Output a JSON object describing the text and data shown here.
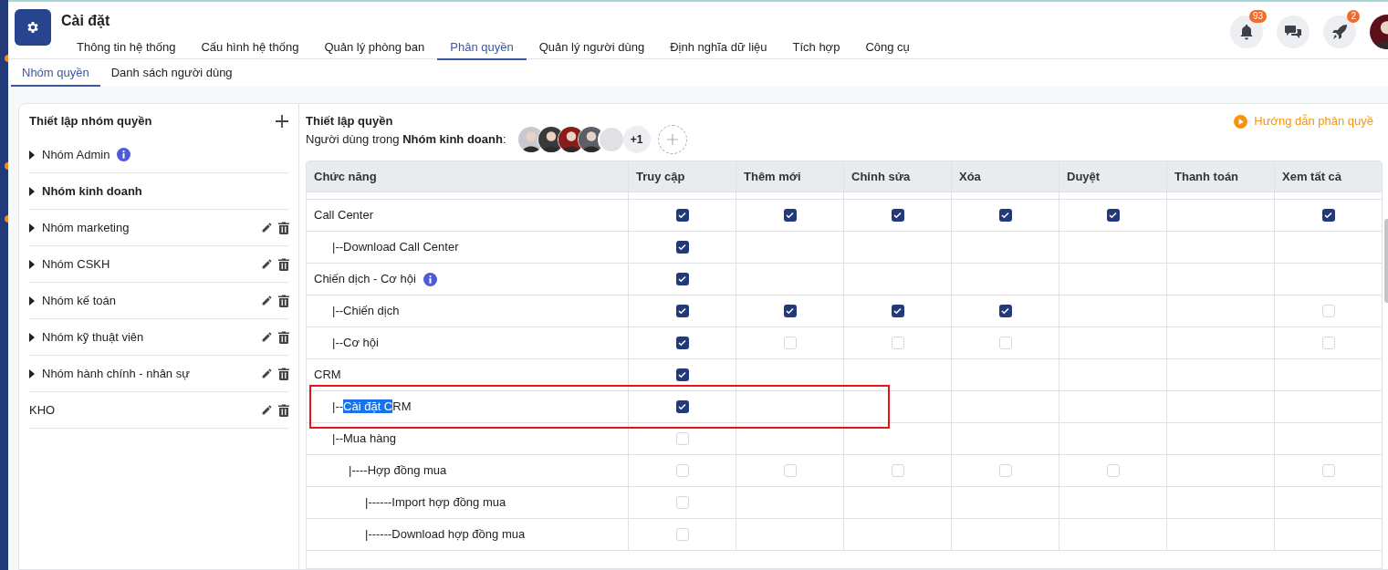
{
  "app": {
    "title": "Cài đặt"
  },
  "nav_tabs": [
    {
      "label": "Thông tin hệ thống",
      "selected": false
    },
    {
      "label": "Cấu hình hệ thống",
      "selected": false
    },
    {
      "label": "Quản lý phòng ban",
      "selected": false
    },
    {
      "label": "Phân quyền",
      "selected": true
    },
    {
      "label": "Quản lý người dùng",
      "selected": false
    },
    {
      "label": "Định nghĩa dữ liệu",
      "selected": false
    },
    {
      "label": "Tích hợp",
      "selected": false
    },
    {
      "label": "Công cụ",
      "selected": false
    }
  ],
  "header_actions": [
    {
      "kind": "bell",
      "badge": "93"
    },
    {
      "kind": "chat"
    },
    {
      "kind": "rocket",
      "badge": "2"
    },
    {
      "kind": "avatar"
    }
  ],
  "sub_tabs": [
    {
      "label": "Nhóm quyền",
      "selected": true
    },
    {
      "label": "Danh sách người dùng",
      "selected": false
    }
  ],
  "groups_panel": {
    "title": "Thiết lập nhóm quyền",
    "groups": [
      {
        "name": "Nhóm Admin",
        "expandable": true,
        "selected": false,
        "info": true,
        "editable": false
      },
      {
        "name": "Nhóm kinh doanh",
        "expandable": true,
        "selected": true,
        "info": false,
        "editable": false
      },
      {
        "name": "Nhóm marketing",
        "expandable": true,
        "selected": false,
        "info": false,
        "editable": true
      },
      {
        "name": "Nhóm CSKH",
        "expandable": true,
        "selected": false,
        "info": false,
        "editable": true
      },
      {
        "name": "Nhóm kế toán",
        "expandable": true,
        "selected": false,
        "info": false,
        "editable": true
      },
      {
        "name": "Nhóm kỹ thuật viên",
        "expandable": true,
        "selected": false,
        "info": false,
        "editable": true
      },
      {
        "name": "Nhóm hành chính - nhân sự",
        "expandable": true,
        "selected": false,
        "info": false,
        "editable": true
      },
      {
        "name": "KHO",
        "expandable": false,
        "selected": false,
        "info": false,
        "editable": true
      }
    ]
  },
  "permissions_panel": {
    "title": "Thiết lập quyền",
    "users_label": "Người dùng trong **Nhóm kinh doanh**:",
    "avatars": [
      {
        "kind": "picture"
      },
      {
        "kind": "picture"
      },
      {
        "kind": "picture"
      },
      {
        "kind": "picture"
      },
      {
        "kind": "blank"
      }
    ],
    "more_users": "+1",
    "guide_link": "Hướng dẫn phân quyề",
    "table": {
      "columns": [
        "Chức năng",
        "Truy cập",
        "Thêm mới",
        "Chỉnh sửa",
        "Xóa",
        "Duyệt",
        "Thanh toán",
        "Xem tất cả"
      ],
      "rows": [
        {
          "label": [
            {
              "text": "Call Center",
              "highlighted": false
            }
          ],
          "info": false,
          "annotated": false,
          "cells": [
            true,
            true,
            true,
            true,
            true,
            null,
            true
          ],
          "children": [
            {
              "label": [
                {
                  "text": "|--Download Call Center",
                  "highlighted": false
                }
              ],
              "info": false,
              "annotated": false,
              "cells": [
                true,
                null,
                null,
                null,
                null,
                null,
                null
              ]
            }
          ]
        },
        {
          "label": [
            {
              "text": "Chiến dịch - Cơ hội",
              "highlighted": false
            }
          ],
          "info": true,
          "annotated": false,
          "cells": [
            true,
            null,
            null,
            null,
            null,
            null,
            null
          ],
          "children": [
            {
              "label": [
                {
                  "text": "|--Chiến dịch",
                  "highlighted": false
                }
              ],
              "info": false,
              "annotated": false,
              "cells": [
                true,
                true,
                true,
                true,
                null,
                null,
                false
              ]
            },
            {
              "label": [
                {
                  "text": "|--Cơ hội",
                  "highlighted": false
                }
              ],
              "info": false,
              "annotated": false,
              "cells": [
                true,
                false,
                false,
                false,
                null,
                null,
                false
              ]
            }
          ]
        },
        {
          "label": [
            {
              "text": "CRM",
              "highlighted": false
            }
          ],
          "info": false,
          "annotated": false,
          "cells": [
            true,
            null,
            null,
            null,
            null,
            null,
            null
          ],
          "children": [
            {
              "label": [
                {
                  "text": "|--",
                  "highlighted": false
                },
                {
                  "text": "Cài đặt C",
                  "highlighted": true
                },
                {
                  "text": "RM",
                  "highlighted": false
                }
              ],
              "info": false,
              "annotated": true,
              "cells": [
                true,
                null,
                null,
                null,
                null,
                null,
                null
              ]
            },
            {
              "label": [
                {
                  "text": "|--Mua hàng",
                  "highlighted": false
                }
              ],
              "info": false,
              "annotated": false,
              "cells": [
                false,
                null,
                null,
                null,
                null,
                null,
                null
              ],
              "children": [
                {
                  "label": [
                    {
                      "text": "|----Hợp đồng mua",
                      "highlighted": false
                    }
                  ],
                  "info": false,
                  "annotated": false,
                  "cells": [
                    false,
                    false,
                    false,
                    false,
                    false,
                    null,
                    false
                  ],
                  "children": [
                    {
                      "label": [
                        {
                          "text": "|------Import hợp đồng mua",
                          "highlighted": false
                        }
                      ],
                      "info": false,
                      "annotated": false,
                      "cells": [
                        false,
                        null,
                        null,
                        null,
                        null,
                        null,
                        null
                      ]
                    },
                    {
                      "label": [
                        {
                          "text": "|------Download hợp đồng mua",
                          "highlighted": false
                        }
                      ],
                      "info": false,
                      "annotated": false,
                      "cells": [
                        false,
                        null,
                        null,
                        null,
                        null,
                        null,
                        null
                      ]
                    }
                  ]
                }
              ]
            }
          ]
        }
      ]
    }
  }
}
